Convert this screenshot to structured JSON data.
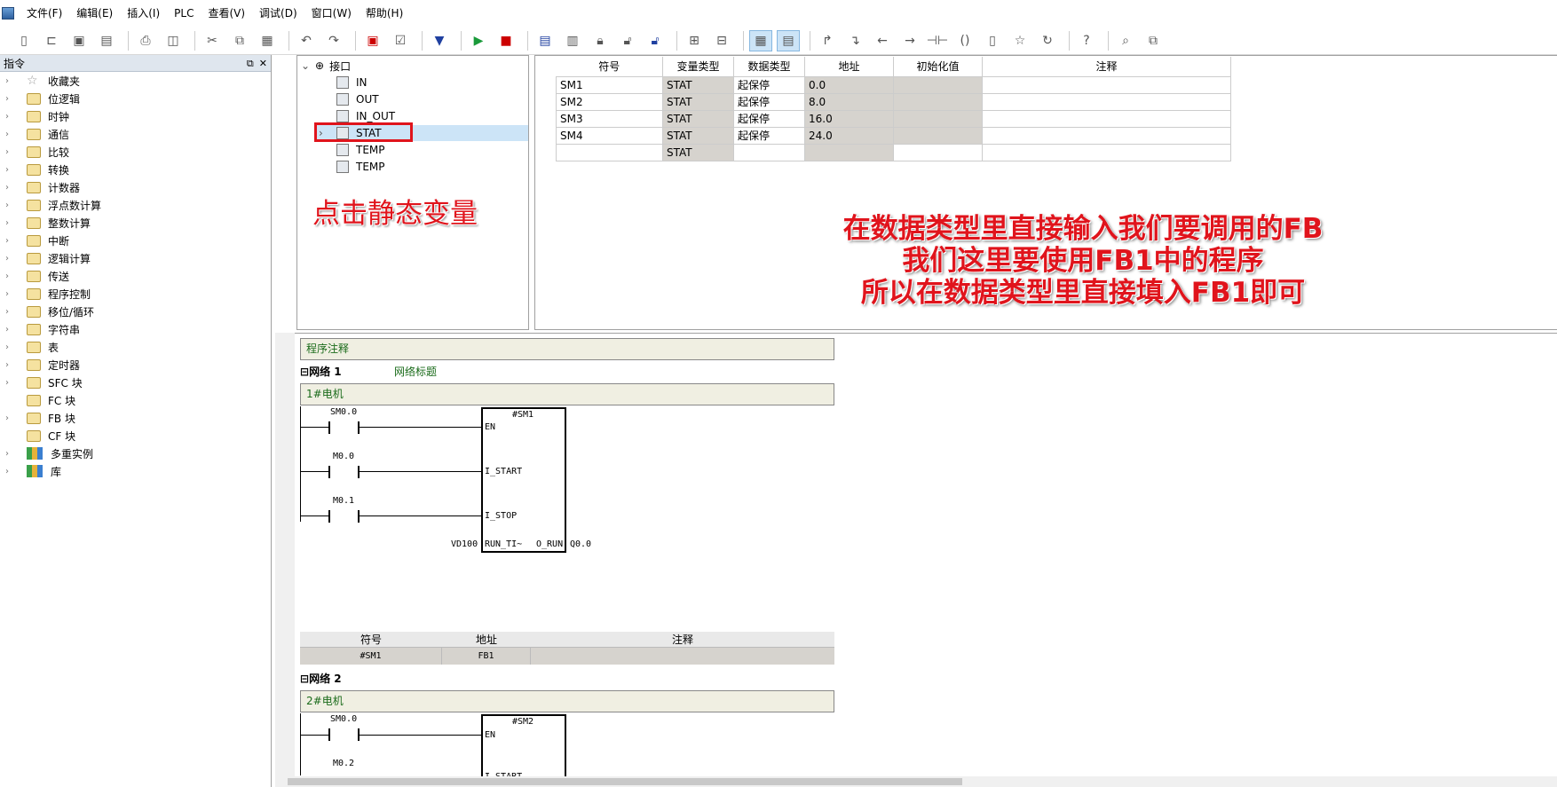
{
  "menu": [
    "文件(F)",
    "编辑(E)",
    "插入(I)",
    "PLC",
    "查看(V)",
    "调试(D)",
    "窗口(W)",
    "帮助(H)"
  ],
  "toolbar_icons": [
    "new-icon",
    "open-icon",
    "save-icon",
    "save-all-icon",
    "print-icon",
    "print-preview-icon",
    "cut-icon",
    "copy-icon",
    "paste-icon",
    "undo-icon",
    "redo-icon",
    "compile-icon",
    "compile-all-icon",
    "download-icon",
    "run-icon",
    "stop-icon",
    "upload-icon",
    "compare-icon",
    "lock-icon",
    "unlock-icon",
    "unlock-all-icon",
    "toggle-symbol-icon",
    "toggle-table-icon",
    "ladder-view-icon",
    "stl-view-icon",
    "contact-up-icon",
    "contact-down-icon",
    "arrow-left-icon",
    "arrow-right-icon",
    "contact-icon",
    "coil-icon",
    "box-icon",
    "star-icon",
    "refresh-icon",
    "help-icon",
    "zoom-icon",
    "window-icon"
  ],
  "left_panel": {
    "title": "指令",
    "items": [
      "收藏夹",
      "位逻辑",
      "时钟",
      "通信",
      "比较",
      "转换",
      "计数器",
      "浮点数计算",
      "整数计算",
      "中断",
      "逻辑计算",
      "传送",
      "程序控制",
      "移位/循环",
      "字符串",
      "表",
      "定时器",
      "SFC 块",
      "FC 块",
      "FB 块",
      "CF 块",
      "多重实例",
      "库"
    ]
  },
  "interface": {
    "root": "接口",
    "items": [
      "IN",
      "OUT",
      "IN_OUT",
      "STAT",
      "TEMP",
      "TEMP"
    ],
    "annotation": "点击静态变量"
  },
  "var_table": {
    "headers": [
      "符号",
      "变量类型",
      "数据类型",
      "地址",
      "初始化值",
      "注释"
    ],
    "rows": [
      [
        "SM1",
        "STAT",
        "起保停",
        "0.0",
        "",
        ""
      ],
      [
        "SM2",
        "STAT",
        "起保停",
        "8.0",
        "",
        ""
      ],
      [
        "SM3",
        "STAT",
        "起保停",
        "16.0",
        "",
        ""
      ],
      [
        "SM4",
        "STAT",
        "起保停",
        "24.0",
        "",
        ""
      ],
      [
        "",
        "STAT",
        "",
        "",
        "",
        ""
      ]
    ]
  },
  "annotation_right": [
    "在数据类型里直接输入我们要调用的FB",
    "我们这里要使用FB1中的程序",
    "所以在数据类型里直接填入FB1即可"
  ],
  "editor": {
    "program_comment": "程序注释",
    "network1": {
      "label": "网络 1",
      "title": "网络标题",
      "comment": "1#电机",
      "fb": "#SM1",
      "contacts": [
        "SM0.0",
        "M0.0",
        "M0.1"
      ],
      "pins_in": [
        "EN",
        "I_START",
        "I_STOP",
        "RUN_TI~"
      ],
      "pin_out": "O_RUN",
      "input_var": "VD100",
      "output_var": "Q0.0"
    },
    "symbol_table": {
      "headers": [
        "符号",
        "地址",
        "注释"
      ],
      "row": [
        "#SM1",
        "FB1",
        ""
      ]
    },
    "network2": {
      "label": "网络 2",
      "comment": "2#电机",
      "fb": "#SM2",
      "contacts": [
        "SM0.0",
        "M0.2"
      ],
      "pins_in": [
        "EN",
        "I_START"
      ]
    }
  }
}
